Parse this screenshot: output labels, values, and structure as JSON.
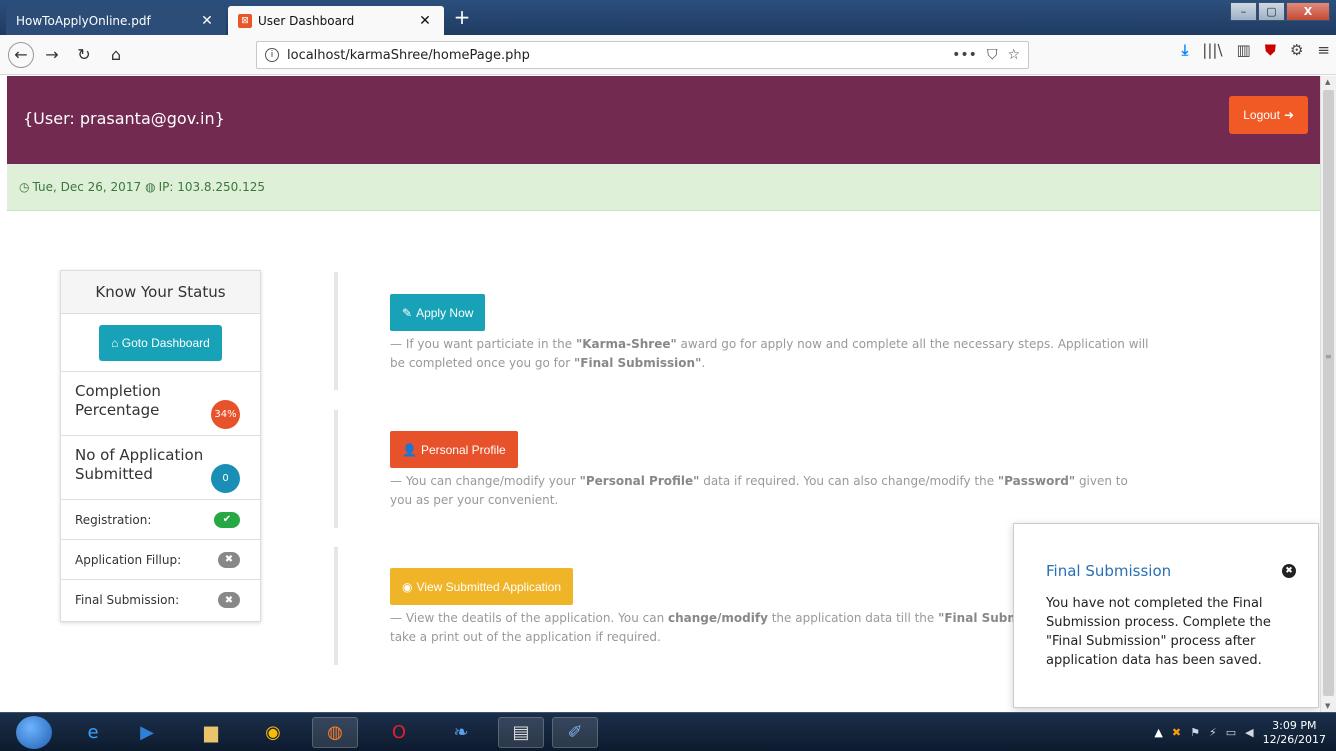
{
  "browser": {
    "tabs": [
      {
        "label": "HowToApplyOnline.pdf",
        "close": "✕"
      },
      {
        "label": "User Dashboard",
        "close": "✕"
      }
    ],
    "url": "localhost/karmaShree/homePage.php",
    "url_actions": [
      "•••",
      "⛉",
      "☆"
    ],
    "window_controls": [
      "–",
      "▢",
      "X"
    ]
  },
  "header": {
    "user": "{User: prasanta@gov.in}",
    "logout_label": "Logout"
  },
  "infobar": {
    "date": "Tue, Dec 26, 2017",
    "ip": "IP: 103.8.250.125"
  },
  "sidebar": {
    "title": "Know Your Status",
    "dashboard_button": "Goto Dashboard",
    "completion_label": "Completion Percentage",
    "completion_value": "34%",
    "applications_label": "No of Application Submitted",
    "applications_value": "0",
    "checks": [
      {
        "label": "Registration:",
        "status": "done"
      },
      {
        "label": "Application Fillup:",
        "status": "pending"
      },
      {
        "label": "Final Submission:",
        "status": "pending"
      }
    ]
  },
  "actions": {
    "apply": {
      "label": "Apply Now",
      "desc_1": "— If you want particiate in the ",
      "bold_1": "\"Karma-Shree\"",
      "desc_2": " award go for apply now and complete all the necessary steps. Application will be completed once you go for ",
      "bold_2": "\"Final Submission\"",
      "desc_3": "."
    },
    "profile": {
      "label": "Personal Profile",
      "desc_1": "— You can change/modify your ",
      "bold_1": "\"Personal Profile\"",
      "desc_2": " data if required. You can also change/modify the ",
      "bold_2": "\"Password\"",
      "desc_3": " given to you as per your convenient."
    },
    "view": {
      "label": "View Submitted Application",
      "desc_1": "— View the deatils of the application. You can ",
      "bold_1": "change/modify",
      "desc_2": " the application data till the ",
      "bold_2": "\"Final Submission\"",
      "desc_3": ". You can also take a print out of the application if required."
    }
  },
  "popup": {
    "title": "Final Submission",
    "body": "You have not completed the Final Submission process. Complete the \"Final Submission\" process after application data has been saved."
  },
  "taskbar": {
    "time": "3:09 PM",
    "date": "12/26/2017"
  },
  "colors": {
    "header": "#722a50",
    "logout": "#f15a24",
    "info": "#17a2b8",
    "danger": "#e8522b",
    "warning": "#f0b429",
    "success": "#28a745"
  }
}
